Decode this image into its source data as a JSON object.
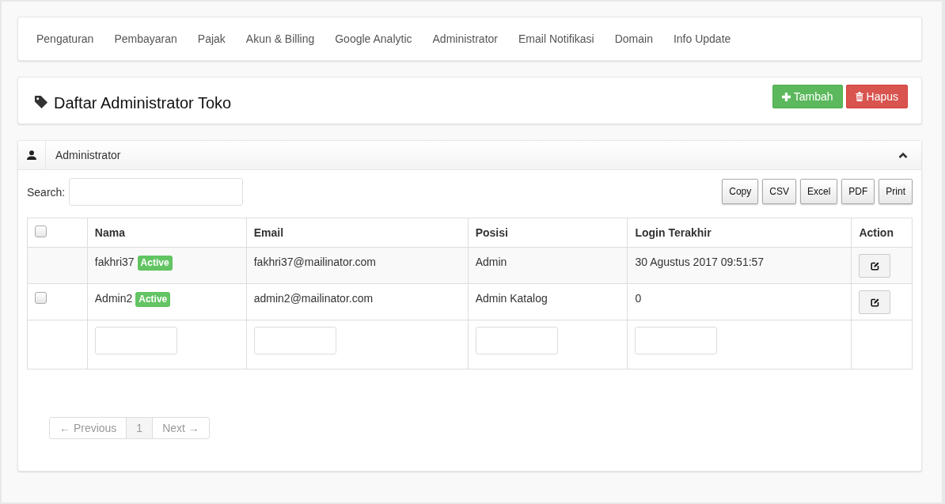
{
  "nav": {
    "items": [
      {
        "label": "Pengaturan"
      },
      {
        "label": "Pembayaran"
      },
      {
        "label": "Pajak"
      },
      {
        "label": "Akun & Billing"
      },
      {
        "label": "Google Analytic"
      },
      {
        "label": "Administrator"
      },
      {
        "label": "Email Notifikasi"
      },
      {
        "label": "Domain"
      },
      {
        "label": "Info Update"
      }
    ]
  },
  "header": {
    "title": "Daftar Administrator Toko",
    "buttons": [
      {
        "kind": "add",
        "label": "Tambah"
      },
      {
        "kind": "delete",
        "label": "Hapus"
      }
    ]
  },
  "panel": {
    "title": "Administrator",
    "expanded": true,
    "search": {
      "label": "Search:"
    },
    "export_buttons": [
      "Copy",
      "CSV",
      "Excel",
      "PDF",
      "Print"
    ],
    "table": {
      "select_all": {
        "checked": false
      },
      "columns": [
        "Nama",
        "Email",
        "Posisi",
        "Login Terakhir",
        "Action"
      ],
      "rows": [
        {
          "name": "fakhri37",
          "status": "Active",
          "email": "fakhri37@mailinator.com",
          "position": "Admin",
          "last_login": "30 Agustus 2017 09:51:57"
        },
        {
          "checked": false,
          "name": "Admin2",
          "status": "Active",
          "email": "admin2@mailinator.com",
          "position": "Admin Katalog",
          "last_login": "0"
        }
      ]
    },
    "pagination": {
      "previous": {
        "label": "← Previous",
        "disabled": true
      },
      "pages": [
        {
          "label": "1",
          "selected": true
        }
      ],
      "next": {
        "label": "Next →",
        "disabled": true
      }
    }
  }
}
